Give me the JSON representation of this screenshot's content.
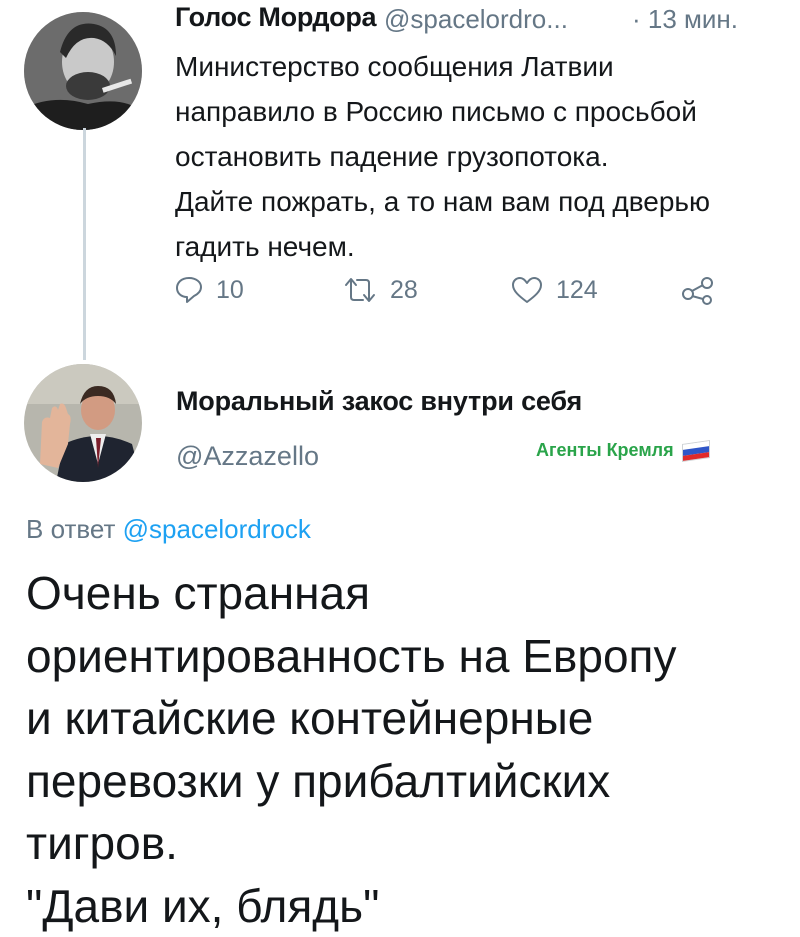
{
  "tweet": {
    "author_name": "Голос Мордора",
    "author_handle": "@spacelordro...",
    "time": "· 13 мин.",
    "text_lines": [
      "Министерство сообщения Латвии",
      "направило в Россию письмо с просьбой",
      "остановить падение грузопотока.",
      "Дайте пожрать, а то нам вам под дверью",
      "гадить нечем."
    ],
    "actions": {
      "reply": {
        "icon": "reply-icon",
        "count": "10"
      },
      "retweet": {
        "icon": "retweet-icon",
        "count": "28"
      },
      "like": {
        "icon": "heart-icon",
        "count": "124"
      },
      "share": {
        "icon": "share-icon"
      }
    }
  },
  "reply": {
    "author_name": "Моральный закос внутри себя",
    "author_handle": "@Azzazello",
    "badge": "Агенты Кремля",
    "badge_color": "#2aa44a",
    "reply_to_prefix": "В ответ",
    "reply_to_handle": "@spacelordrock",
    "text_lines": [
      "Очень странная",
      "ориентированность на Европу",
      "и китайские контейнерные",
      "перевозки у прибалтийских",
      "тигров.",
      "\"Дави их, блядь\""
    ]
  },
  "colors": {
    "text": "#14171a",
    "secondary": "#657786",
    "link": "#1da1f2",
    "thread_line": "#ccd6dd"
  }
}
